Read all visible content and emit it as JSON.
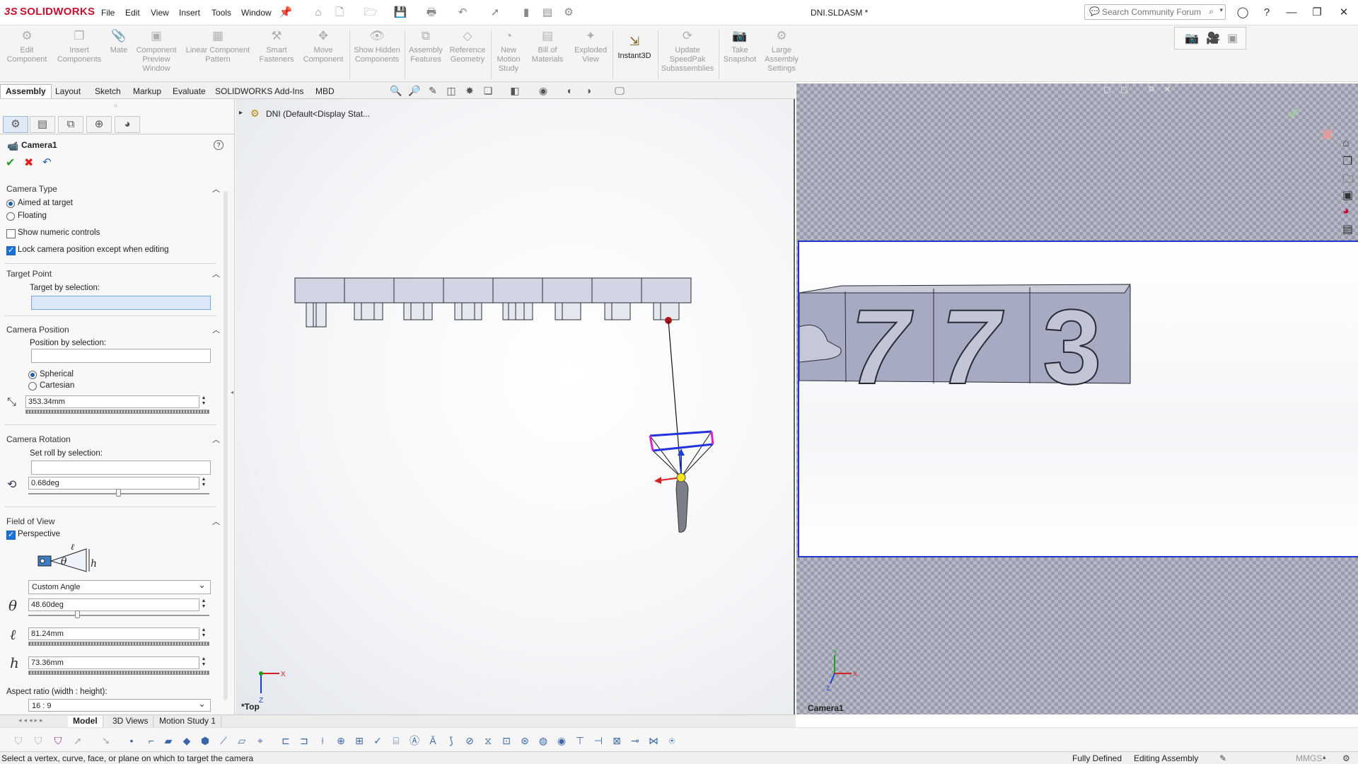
{
  "app": {
    "brand_prefix": "3S",
    "brand": "SOLIDWORKS",
    "document_title": "DNI.SLDASM *"
  },
  "menu": [
    "File",
    "Edit",
    "View",
    "Insert",
    "Tools",
    "Window"
  ],
  "search": {
    "placeholder": "Search Community Forum"
  },
  "ribbon": {
    "buttons": [
      {
        "label": "Edit Component",
        "icon": "edit-component-icon"
      },
      {
        "label": "Insert Components",
        "icon": "insert-components-icon"
      },
      {
        "label": "Mate",
        "icon": "mate-icon"
      },
      {
        "label": "Component Preview Window",
        "icon": "component-preview-icon"
      },
      {
        "label": "Linear Component Pattern",
        "icon": "linear-pattern-icon"
      },
      {
        "label": "Smart Fasteners",
        "icon": "smart-fasteners-icon"
      },
      {
        "label": "Move Component",
        "icon": "move-component-icon"
      },
      {
        "label": "Show Hidden Components",
        "icon": "show-hidden-icon"
      },
      {
        "label": "Assembly Features",
        "icon": "assembly-features-icon"
      },
      {
        "label": "Reference Geometry",
        "icon": "reference-geometry-icon"
      },
      {
        "label": "New Motion Study",
        "icon": "motion-study-icon"
      },
      {
        "label": "Bill of Materials",
        "icon": "bom-icon"
      },
      {
        "label": "Exploded View",
        "icon": "exploded-view-icon"
      },
      {
        "label": "Instant3D",
        "icon": "instant3d-icon"
      },
      {
        "label": "Update SpeedPak Subassemblies",
        "icon": "speedpak-icon"
      },
      {
        "label": "Take Snapshot",
        "icon": "snapshot-icon"
      },
      {
        "label": "Large Assembly Settings",
        "icon": "large-assembly-icon"
      }
    ]
  },
  "command_tabs": [
    "Assembly",
    "Layout",
    "Sketch",
    "Markup",
    "Evaluate",
    "SOLIDWORKS Add-Ins",
    "MBD"
  ],
  "tree": {
    "root": "DNI  (Default<Display Stat..."
  },
  "pm": {
    "title": "Camera1",
    "camera_type": {
      "title": "Camera Type",
      "aimed": "Aimed at target",
      "floating": "Floating",
      "numeric": "Show numeric controls",
      "lock": "Lock camera position except when editing"
    },
    "target_point": {
      "title": "Target Point",
      "label": "Target by selection:"
    },
    "camera_position": {
      "title": "Camera Position",
      "label": "Position by selection:",
      "spherical": "Spherical",
      "cartesian": "Cartesian",
      "distance": "353.34mm"
    },
    "camera_rotation": {
      "title": "Camera Rotation",
      "label": "Set roll by selection:",
      "roll": "0.68deg"
    },
    "fov": {
      "title": "Field of View",
      "perspective": "Perspective",
      "angle_mode": "Custom Angle",
      "theta_symbol": "θ",
      "l_symbol": "ℓ",
      "h_symbol": "h",
      "theta": "48.60deg",
      "l": "81.24mm",
      "h": "73.36mm",
      "aspect_label": "Aspect ratio (width : height):",
      "aspect": "16 : 9"
    }
  },
  "viewport": {
    "left_label": "*Top",
    "right_label": "Camera1",
    "axis_x": "X",
    "axis_y": "Y",
    "axis_z": "Z"
  },
  "camera_digits": [
    "7",
    "7",
    "3"
  ],
  "bottom_tabs": [
    "Model",
    "3D Views",
    "Motion Study 1"
  ],
  "status": {
    "hint": "Select a vertex, curve, face, or plane on which to target the camera",
    "defined": "Fully Defined",
    "mode": "Editing Assembly",
    "units": "MMGS"
  },
  "colors": {
    "brand": "#c8102e",
    "accent": "#1a73d9",
    "camera_frame": "#2233cc"
  }
}
